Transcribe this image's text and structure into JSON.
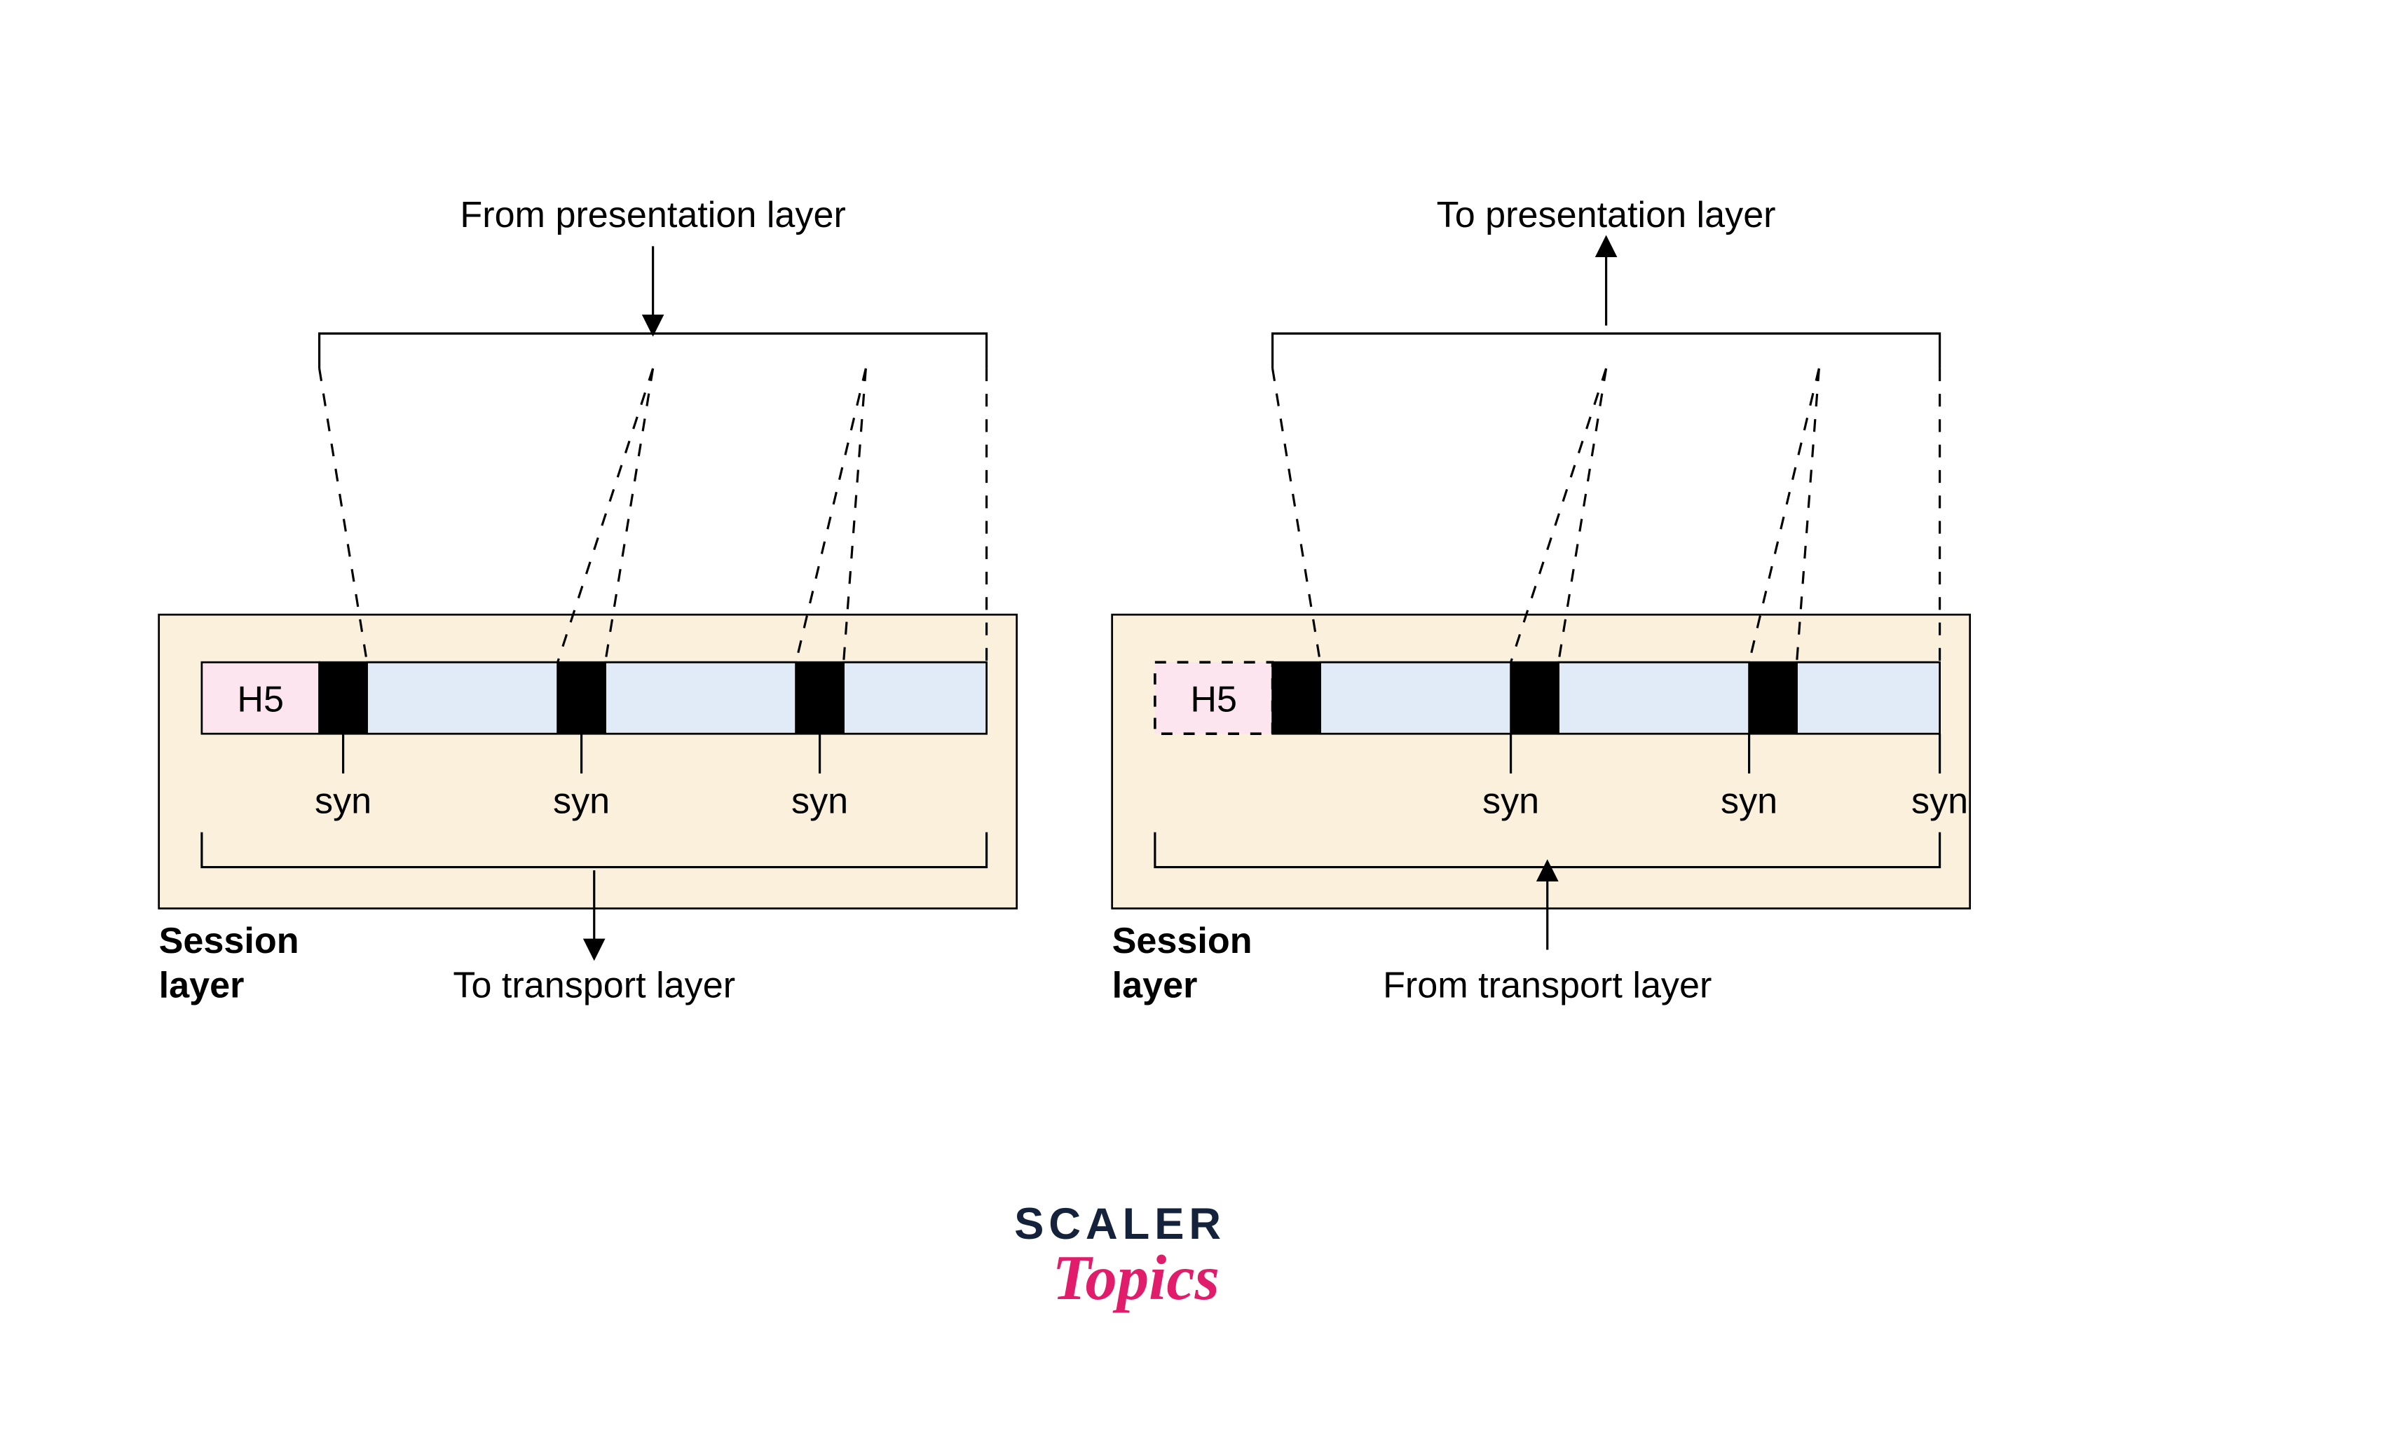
{
  "left": {
    "topLabel": "From presentation layer",
    "bottomLabel": "To transport layer",
    "header": "H5",
    "synLabels": [
      "syn",
      "syn",
      "syn"
    ],
    "layerTitle": "Session",
    "layerTitle2": "layer"
  },
  "right": {
    "topLabel": "To presentation layer",
    "bottomLabel": "From transport layer",
    "header": "H5",
    "synLabels": [
      "syn",
      "syn",
      "syn"
    ],
    "layerTitle": "Session",
    "layerTitle2": "layer"
  },
  "brand": {
    "top": "SCALER",
    "bottom": "Topics"
  }
}
